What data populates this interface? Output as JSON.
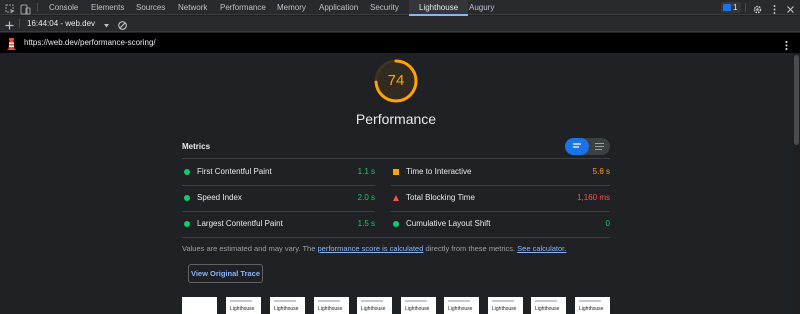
{
  "devtools": {
    "tabs": [
      "Console",
      "Elements",
      "Sources",
      "Network",
      "Performance",
      "Memory",
      "Application",
      "Security",
      "Lighthouse",
      "Augury"
    ],
    "active_tab": "Lighthouse",
    "issues_count": "1"
  },
  "toolbar": {
    "report_selector": "16:44:04 - web.dev"
  },
  "urlbar": {
    "url": "https://web.dev/performance-scoring/"
  },
  "report": {
    "score": "74",
    "category_title": "Performance",
    "metrics_title": "Metrics",
    "metrics": [
      {
        "label": "First Contentful Paint",
        "value": "1.1 s",
        "rating": "pass"
      },
      {
        "label": "Time to Interactive",
        "value": "5.6 s",
        "rating": "average"
      },
      {
        "label": "Speed Index",
        "value": "2.0 s",
        "rating": "pass"
      },
      {
        "label": "Total Blocking Time",
        "value": "1,160 ms",
        "rating": "fail"
      },
      {
        "label": "Largest Contentful Paint",
        "value": "1.5 s",
        "rating": "pass"
      },
      {
        "label": "Cumulative Layout Shift",
        "value": "0",
        "rating": "pass"
      }
    ],
    "note": {
      "prefix": "Values are estimated and may vary. The ",
      "link1": "performance score is calculated",
      "middle": " directly from these metrics. ",
      "link2": "See calculator."
    },
    "view_trace_button": "View Original Trace",
    "thumbnail_caption": "Lighthouse"
  },
  "colors": {
    "pass": "#0cce6b",
    "average": "#ffa400",
    "fail": "#ff4e42",
    "link": "#8ab4f8",
    "accent": "#1a73e8"
  }
}
